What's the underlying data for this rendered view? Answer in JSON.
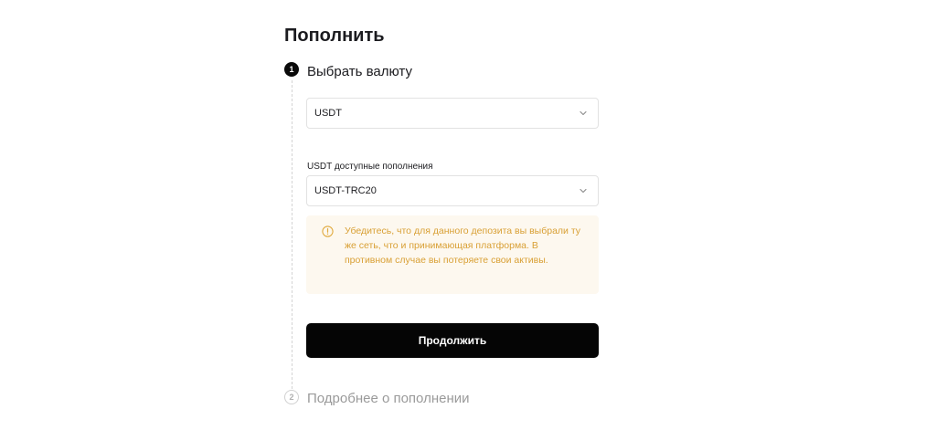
{
  "page": {
    "title": "Пополнить"
  },
  "steps": [
    {
      "number": "1",
      "label": "Выбрать валюту",
      "state": "active"
    },
    {
      "number": "2",
      "label": "Подробнее о пополнении",
      "state": "inactive"
    }
  ],
  "currency_select": {
    "value": "USDT",
    "icon": "chevron-down-icon"
  },
  "network_select": {
    "label": "USDT доступные пополнения",
    "value": "USDT-TRC20",
    "icon": "chevron-down-icon"
  },
  "warning": {
    "icon": "warning-circle-icon",
    "text": "Убедитесь, что для данного депозита вы выбрали ту же сеть, что и принимающая платформа. В противном случае вы потеряете свои активы.",
    "color": "#d9a035",
    "background": "#fdf8ef"
  },
  "actions": {
    "continue_label": "Продолжить"
  },
  "colors": {
    "primary": "#050505",
    "muted": "#9a9a9a"
  }
}
